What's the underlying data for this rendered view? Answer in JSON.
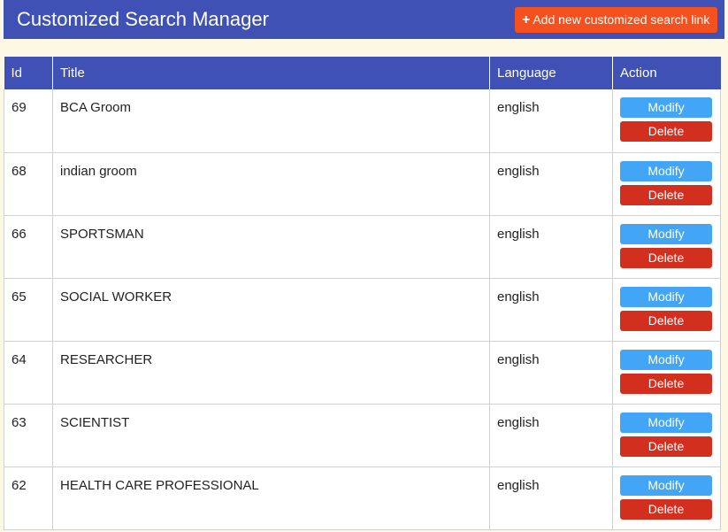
{
  "header": {
    "title": "Customized Search Manager",
    "add_button_label": "Add new customized search link"
  },
  "table": {
    "columns": [
      "Id",
      "Title",
      "Language",
      "Action"
    ],
    "rows": [
      {
        "id": "69",
        "title": "BCA Groom",
        "language": "english"
      },
      {
        "id": "68",
        "title": "indian groom",
        "language": "english"
      },
      {
        "id": "66",
        "title": "SPORTSMAN",
        "language": "english"
      },
      {
        "id": "65",
        "title": "SOCIAL WORKER",
        "language": "english"
      },
      {
        "id": "64",
        "title": "RESEARCHER",
        "language": "english"
      },
      {
        "id": "63",
        "title": "SCIENTIST",
        "language": "english"
      },
      {
        "id": "62",
        "title": "HEALTH CARE PROFESSIONAL",
        "language": "english"
      }
    ],
    "modify_label": "Modify",
    "delete_label": "Delete"
  },
  "colors": {
    "header_bg": "#3f51b5",
    "add_button": "#f4511e",
    "modify_button": "#42a5f5",
    "delete_button": "#d32f1f",
    "page_bg": "#fdf8e4"
  },
  "icons": {
    "add": "plus-icon"
  }
}
